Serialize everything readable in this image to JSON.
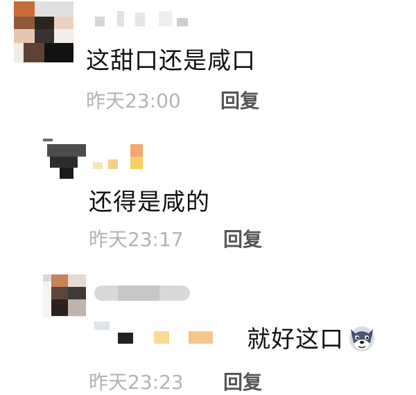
{
  "comments": [
    {
      "text": "这甜口还是咸口",
      "time": "昨天23:00",
      "reply_label": "回复",
      "avatar_icon": "pixelated-avatar-icon"
    },
    {
      "text": "还得是咸的",
      "time": "昨天23:17",
      "reply_label": "回复",
      "avatar_icon": "pixelated-avatar-icon"
    },
    {
      "text": "就好这口",
      "emoji": "wolf-emoji-icon",
      "time": "昨天23:23",
      "reply_label": "回复",
      "avatar_icon": "pixelated-avatar-icon"
    }
  ],
  "colors": {
    "text": "#111111",
    "timestamp": "#b3b3b3",
    "reply": "#555555"
  }
}
